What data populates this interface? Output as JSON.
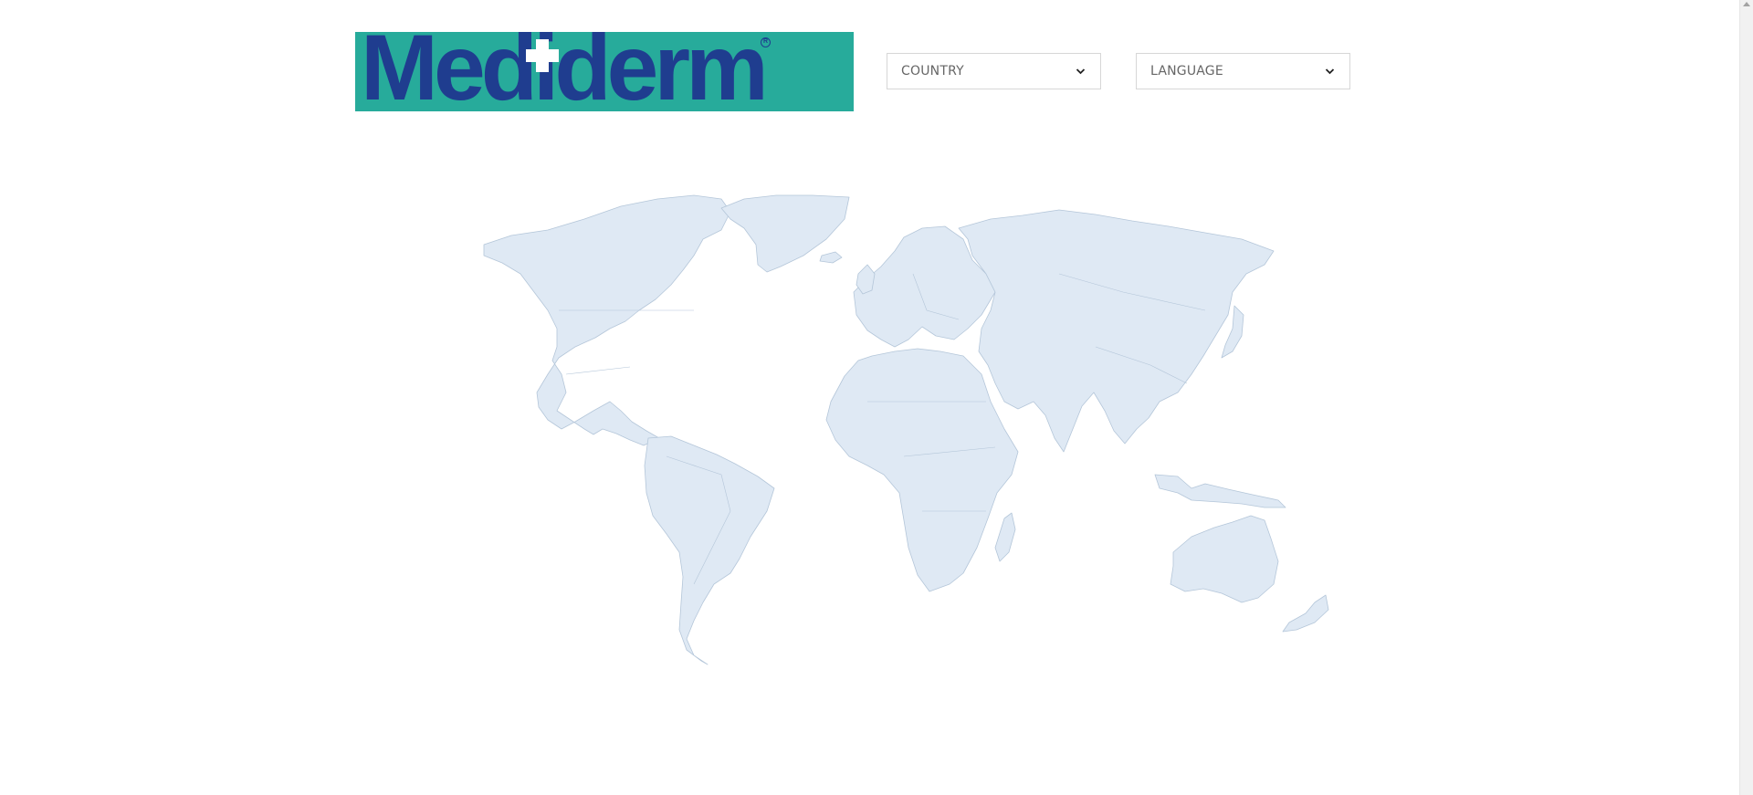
{
  "brand": {
    "name": "Mediderm",
    "accent_color": "#27ab9b",
    "text_color": "#1f3d8f"
  },
  "selectors": {
    "country": {
      "label": "COUNTRY",
      "icon": "chevron-down-icon"
    },
    "language": {
      "label": "LANGUAGE",
      "icon": "chevron-down-icon"
    }
  },
  "map": {
    "land_color": "#dfe9f4",
    "border_color": "#b4c6d9"
  }
}
